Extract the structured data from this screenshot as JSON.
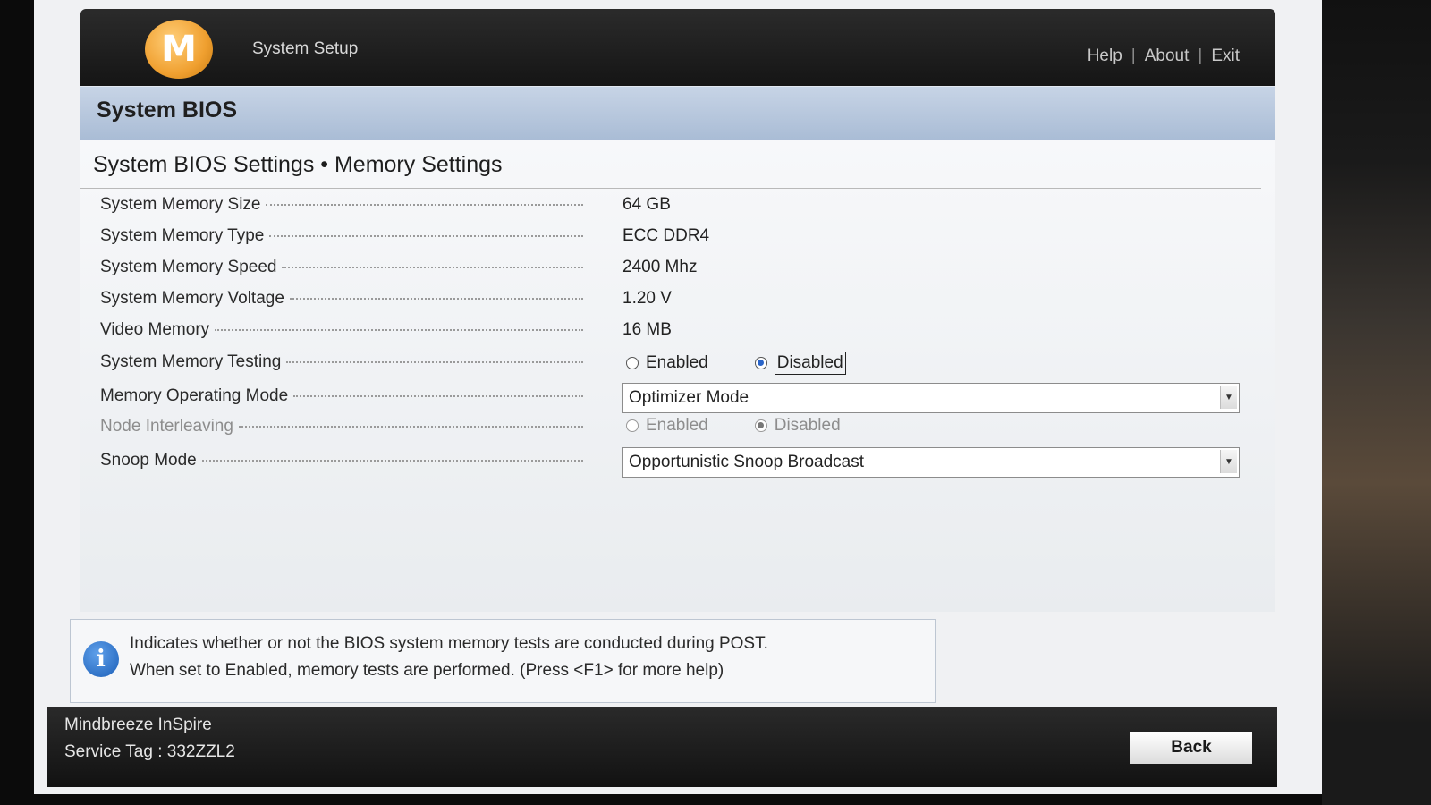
{
  "header": {
    "logo_letter": "M",
    "app_title": "System Setup",
    "links": [
      "Help",
      "About",
      "Exit"
    ],
    "separator": "|"
  },
  "section": {
    "title": "System BIOS"
  },
  "page": {
    "title": "System BIOS Settings • Memory Settings"
  },
  "settings": [
    {
      "label": "System Memory Size",
      "value": "64 GB"
    },
    {
      "label": "System Memory Type",
      "value": "ECC DDR4"
    },
    {
      "label": "System Memory Speed",
      "value": "2400 Mhz"
    },
    {
      "label": "System Memory Voltage",
      "value": "1.20 V"
    },
    {
      "label": "Video Memory",
      "value": "16 MB"
    },
    {
      "label": "System Memory Testing",
      "options": [
        "Enabled",
        "Disabled"
      ],
      "selected": "Disabled"
    },
    {
      "label": "Memory Operating Mode",
      "value": "Optimizer Mode"
    },
    {
      "label": "Node Interleaving",
      "options": [
        "Enabled",
        "Disabled"
      ],
      "selected": "Disabled",
      "disabled": true
    },
    {
      "label": "Snoop Mode",
      "value": "Opportunistic Snoop Broadcast"
    }
  ],
  "help": {
    "line1": "Indicates whether or not the BIOS system memory tests are conducted during POST.",
    "line2": "When set to Enabled, memory tests are performed. (Press <F1> for more help)"
  },
  "footer": {
    "product": "Mindbreeze InSpire",
    "service_tag": "Service Tag : 332ZZL2",
    "back_label": "Back"
  },
  "colors": {
    "header_bg": "#1e1e1e",
    "band_bg": "#b8c8de",
    "radio_selected": "#2a64c8",
    "info_icon": "#1c5fb8"
  }
}
